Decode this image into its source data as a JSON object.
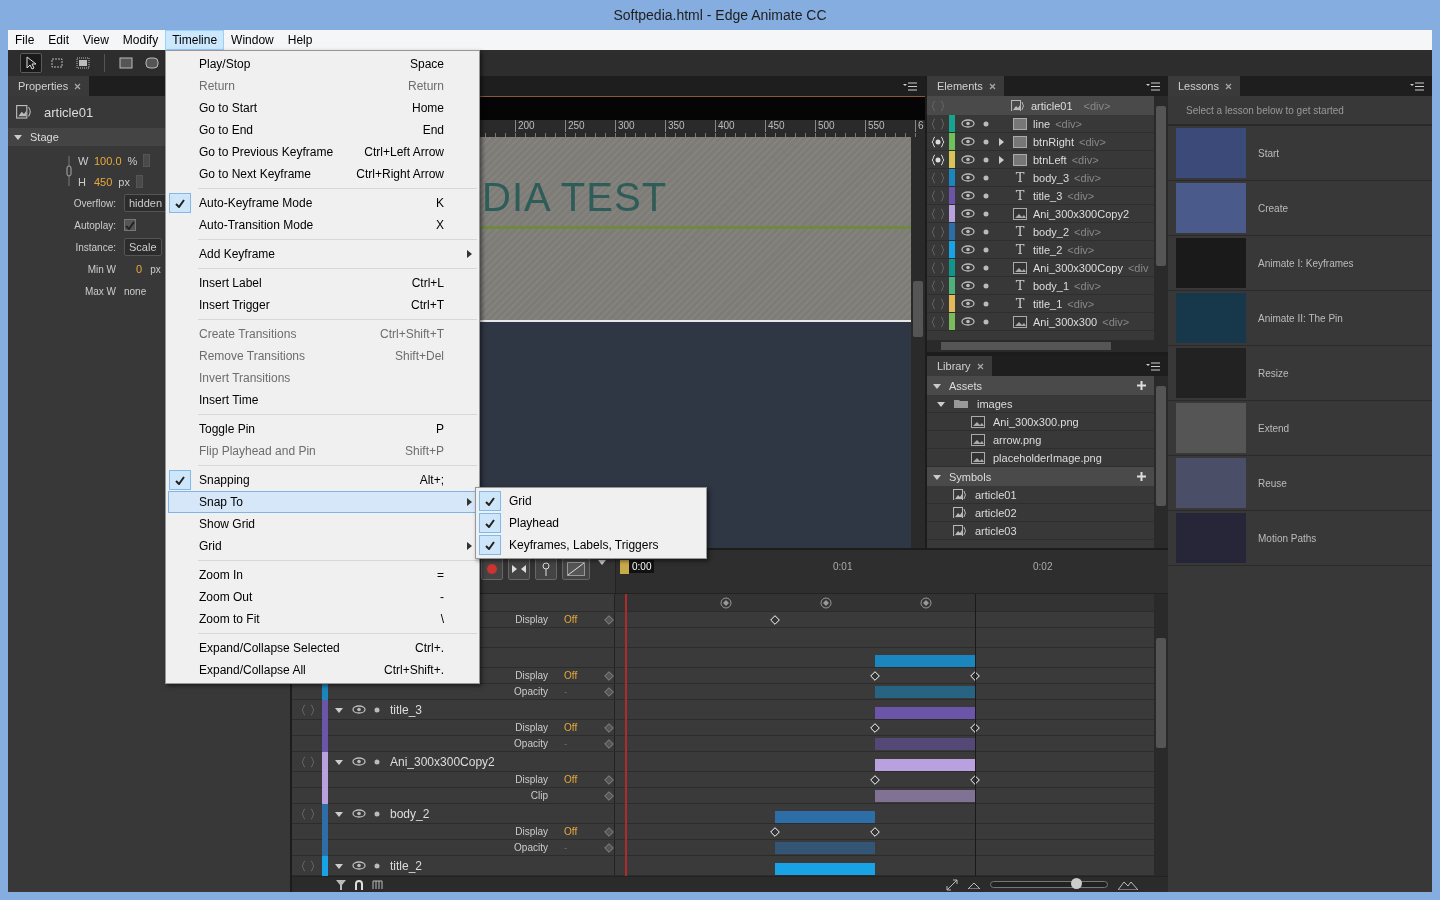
{
  "window": {
    "title": "Softpedia.html - Edge Animate CC"
  },
  "menubar": [
    {
      "label": "File",
      "selected": false
    },
    {
      "label": "Edit",
      "selected": false
    },
    {
      "label": "View",
      "selected": false
    },
    {
      "label": "Modify",
      "selected": false
    },
    {
      "label": "Timeline",
      "selected": true
    },
    {
      "label": "Window",
      "selected": false
    },
    {
      "label": "Help",
      "selected": false
    }
  ],
  "tools": [
    {
      "kind": "select",
      "selected": true
    },
    {
      "kind": "transform",
      "selected": false
    },
    {
      "kind": "clip",
      "selected": false
    },
    {
      "kind": "rectangle",
      "selected": false
    },
    {
      "kind": "rounded_rectangle",
      "selected": false
    }
  ],
  "properties": {
    "tab": "Properties",
    "symbol": "article01",
    "section": {
      "title": "Stage",
      "expanded": true
    },
    "width": {
      "label": "W",
      "value": "100.0",
      "unit": "%"
    },
    "height": {
      "label": "H",
      "value": "450",
      "unit": "px"
    },
    "fields": [
      {
        "kind": "select",
        "label": "Overflow:",
        "value": "hidden"
      },
      {
        "kind": "checkbox",
        "label": "Autoplay:",
        "checked": true
      },
      {
        "kind": "select",
        "label": "Instance:",
        "value": "Scale"
      },
      {
        "kind": "number",
        "label": "Min W",
        "value": "0",
        "unit": "px"
      },
      {
        "kind": "text",
        "label": "Max W",
        "value": "none"
      }
    ]
  },
  "stage": {
    "ruler": [
      "200",
      "250",
      "300",
      "350",
      "400",
      "450",
      "500",
      "550",
      "6"
    ],
    "heading": "DIA TEST"
  },
  "elements": {
    "tab": "Elements",
    "root": {
      "name": "article01",
      "tag": "<div>"
    },
    "items": [
      {
        "name": "line",
        "tag": "<div>",
        "color": "#17a38f",
        "kind": "rect",
        "actions": false
      },
      {
        "name": "btnRight",
        "tag": "<div>",
        "color": "#6fbf5a",
        "kind": "rect",
        "actions": true,
        "expanded": false
      },
      {
        "name": "btnLeft",
        "tag": "<div>",
        "color": "#d7c35a",
        "kind": "rect",
        "actions": true,
        "expanded": false
      },
      {
        "name": "body_3",
        "tag": "<div>",
        "color": "#1a86bd",
        "kind": "text",
        "glyph": "T",
        "actions": false
      },
      {
        "name": "title_3",
        "tag": "<div>",
        "color": "#6a55a8",
        "kind": "text",
        "glyph": "T",
        "actions": false
      },
      {
        "name": "Ani_300x300Copy2",
        "color": "#b9a0df",
        "kind": "image",
        "actions": false
      },
      {
        "name": "body_2",
        "tag": "<div>",
        "color": "#2e6ea8",
        "kind": "text",
        "glyph": "T",
        "actions": false
      },
      {
        "name": "title_2",
        "tag": "<div>",
        "color": "#17a3e6",
        "kind": "text",
        "glyph": "T",
        "actions": false
      },
      {
        "name": "Ani_300x300Copy",
        "tag": "<div",
        "color": "#11958a",
        "kind": "image",
        "actions": false
      },
      {
        "name": "body_1",
        "tag": "<div>",
        "color": "#4eb07a",
        "kind": "text",
        "glyph": "T",
        "actions": false
      },
      {
        "name": "title_1",
        "tag": "<div>",
        "color": "#e2b95a",
        "kind": "text",
        "glyph": "T",
        "actions": false
      },
      {
        "name": "Ani_300x300",
        "tag": "<div>",
        "color": "#7cb95a",
        "kind": "image",
        "actions": false
      }
    ]
  },
  "library": {
    "tab": "Library",
    "sections": [
      {
        "title": "Assets",
        "expanded": true,
        "children": [
          {
            "name": "images",
            "kind": "folder",
            "expanded": true,
            "children": [
              {
                "name": "Ani_300x300.png",
                "kind": "image"
              },
              {
                "name": "arrow.png",
                "kind": "image"
              },
              {
                "name": "placeholderImage.png",
                "kind": "image"
              }
            ]
          }
        ]
      },
      {
        "title": "Symbols",
        "expanded": true,
        "children": [
          {
            "name": "article01",
            "kind": "symbol"
          },
          {
            "name": "article02",
            "kind": "symbol"
          },
          {
            "name": "article03",
            "kind": "symbol"
          }
        ]
      }
    ]
  },
  "lessons": {
    "tab": "Lessons",
    "intro": "Select a lesson below to get started",
    "items": [
      {
        "title": "Start"
      },
      {
        "title": "Create"
      },
      {
        "title": "Animate I: Keyframes"
      },
      {
        "title": "Animate II: The Pin"
      },
      {
        "title": "Resize"
      },
      {
        "title": "Extend"
      },
      {
        "title": "Reuse"
      },
      {
        "title": "Motion Paths"
      }
    ]
  },
  "timeline": {
    "time_ruler": [
      "0:00",
      "0:01",
      "0:02"
    ],
    "groups": [
      {
        "kind": "stage",
        "children": [
          {
            "label": "Display",
            "value": "Off"
          }
        ]
      },
      {
        "kind": "element",
        "color": "#1a86bd",
        "children": [
          {
            "label": "Display",
            "value": "Off"
          },
          {
            "label": "Opacity",
            "value": "-"
          }
        ]
      },
      {
        "kind": "element",
        "name": "title_3",
        "color": "#6a55a8",
        "expanded": true,
        "children": [
          {
            "label": "Display",
            "value": "Off"
          },
          {
            "label": "Opacity",
            "value": "-"
          }
        ]
      },
      {
        "kind": "element",
        "name": "Ani_300x300Copy2",
        "color": "#b9a0df",
        "expanded": true,
        "children": [
          {
            "label": "Display",
            "value": "Off"
          },
          {
            "label": "Clip"
          }
        ]
      },
      {
        "kind": "element",
        "name": "body_2",
        "color": "#2e6ea8",
        "expanded": true,
        "children": [
          {
            "label": "Display",
            "value": "Off"
          },
          {
            "label": "Opacity",
            "value": "-"
          }
        ]
      },
      {
        "kind": "element",
        "name": "title_2",
        "color": "#17a3e6",
        "expanded": true
      }
    ],
    "zoom": {
      "level": 0.73
    }
  },
  "timeline_menu": {
    "items": [
      {
        "kind": "item",
        "label": "Play/Stop",
        "shortcut": "Space",
        "disabled": false,
        "checked": false,
        "selected": false,
        "submenu": false
      },
      {
        "kind": "item",
        "label": "Return",
        "shortcut": "Return",
        "disabled": true,
        "checked": false,
        "selected": false,
        "submenu": false
      },
      {
        "kind": "item",
        "label": "Go to Start",
        "shortcut": "Home",
        "disabled": false,
        "checked": false,
        "selected": false,
        "submenu": false
      },
      {
        "kind": "item",
        "label": "Go to End",
        "shortcut": "End",
        "disabled": false,
        "checked": false,
        "selected": false,
        "submenu": false
      },
      {
        "kind": "item",
        "label": "Go to Previous Keyframe",
        "shortcut": "Ctrl+Left Arrow",
        "disabled": false,
        "checked": false,
        "selected": false,
        "submenu": false
      },
      {
        "kind": "item",
        "label": "Go to Next Keyframe",
        "shortcut": "Ctrl+Right Arrow",
        "disabled": false,
        "checked": false,
        "selected": false,
        "submenu": false
      },
      {
        "kind": "separator"
      },
      {
        "kind": "item",
        "label": "Auto-Keyframe Mode",
        "shortcut": "K",
        "disabled": false,
        "checked": true,
        "selected": false,
        "submenu": false
      },
      {
        "kind": "item",
        "label": "Auto-Transition Mode",
        "shortcut": "X",
        "disabled": false,
        "checked": false,
        "selected": false,
        "submenu": false
      },
      {
        "kind": "separator"
      },
      {
        "kind": "item",
        "label": "Add Keyframe",
        "disabled": false,
        "checked": false,
        "selected": false,
        "submenu": true
      },
      {
        "kind": "separator"
      },
      {
        "kind": "item",
        "label": "Insert Label",
        "shortcut": "Ctrl+L",
        "disabled": false,
        "checked": false,
        "selected": false,
        "submenu": false
      },
      {
        "kind": "item",
        "label": "Insert Trigger",
        "shortcut": "Ctrl+T",
        "disabled": false,
        "checked": false,
        "selected": false,
        "submenu": false
      },
      {
        "kind": "separator"
      },
      {
        "kind": "item",
        "label": "Create Transitions",
        "shortcut": "Ctrl+Shift+T",
        "disabled": true,
        "checked": false,
        "selected": false,
        "submenu": false
      },
      {
        "kind": "item",
        "label": "Remove Transitions",
        "shortcut": "Shift+Del",
        "disabled": true,
        "checked": false,
        "selected": false,
        "submenu": false
      },
      {
        "kind": "item",
        "label": "Invert Transitions",
        "disabled": true,
        "checked": false,
        "selected": false,
        "submenu": false
      },
      {
        "kind": "item",
        "label": "Insert Time",
        "disabled": false,
        "checked": false,
        "selected": false,
        "submenu": false
      },
      {
        "kind": "separator"
      },
      {
        "kind": "item",
        "label": "Toggle Pin",
        "shortcut": "P",
        "disabled": false,
        "checked": false,
        "selected": false,
        "submenu": false
      },
      {
        "kind": "item",
        "label": "Flip Playhead and Pin",
        "shortcut": "Shift+P",
        "disabled": true,
        "checked": false,
        "selected": false,
        "submenu": false
      },
      {
        "kind": "separator"
      },
      {
        "kind": "item",
        "label": "Snapping",
        "shortcut": "Alt+;",
        "disabled": false,
        "checked": true,
        "selected": false,
        "submenu": false
      },
      {
        "kind": "item",
        "label": "Snap To",
        "disabled": false,
        "checked": false,
        "selected": true,
        "submenu": true
      },
      {
        "kind": "item",
        "label": "Show Grid",
        "disabled": false,
        "checked": false,
        "selected": false,
        "submenu": false
      },
      {
        "kind": "item",
        "label": "Grid",
        "disabled": false,
        "checked": false,
        "selected": false,
        "submenu": true
      },
      {
        "kind": "separator"
      },
      {
        "kind": "item",
        "label": "Zoom In",
        "shortcut": "=",
        "disabled": false,
        "checked": false,
        "selected": false,
        "submenu": false
      },
      {
        "kind": "item",
        "label": "Zoom Out",
        "shortcut": "-",
        "disabled": false,
        "checked": false,
        "selected": false,
        "submenu": false
      },
      {
        "kind": "item",
        "label": "Zoom to Fit",
        "shortcut": "\\",
        "disabled": false,
        "checked": false,
        "selected": false,
        "submenu": false
      },
      {
        "kind": "separator"
      },
      {
        "kind": "item",
        "label": "Expand/Collapse Selected",
        "shortcut": "Ctrl+.",
        "disabled": false,
        "checked": false,
        "selected": false,
        "submenu": false
      },
      {
        "kind": "item",
        "label": "Expand/Collapse All",
        "shortcut": "Ctrl+Shift+.",
        "disabled": false,
        "checked": false,
        "selected": false,
        "submenu": false
      }
    ]
  },
  "snap_to_menu": {
    "items": [
      {
        "label": "Grid",
        "checked": true
      },
      {
        "label": "Playhead",
        "checked": true
      },
      {
        "label": "Keyframes, Labels, Triggers",
        "checked": true
      }
    ]
  }
}
